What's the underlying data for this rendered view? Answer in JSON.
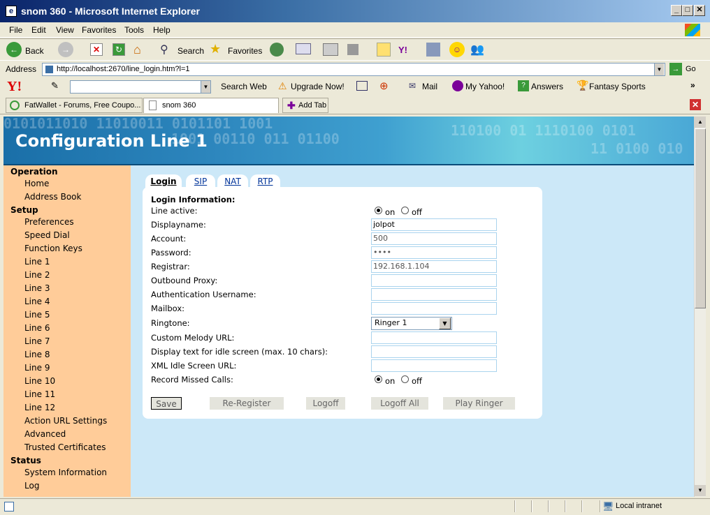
{
  "window": {
    "title": "snom 360 - Microsoft Internet Explorer",
    "icon": "ie-page-icon"
  },
  "menu": [
    "File",
    "Edit",
    "View",
    "Favorites",
    "Tools",
    "Help"
  ],
  "toolbar": {
    "back": "Back",
    "search": "Search",
    "favorites": "Favorites"
  },
  "address": {
    "label": "Address",
    "url": "http://localhost:2670/line_login.htm?l=1",
    "go": "Go"
  },
  "yahoo": {
    "search_web": "Search Web",
    "upgrade": "Upgrade Now!",
    "mail": "Mail",
    "my_yahoo": "My Yahoo!",
    "answers": "Answers",
    "fantasy": "Fantasy Sports"
  },
  "tabs": {
    "tab1": "FatWallet - Forums, Free Coupo...",
    "tab2": "snom 360",
    "add": "Add Tab"
  },
  "page": {
    "header": "Configuration Line 1",
    "sidebar": {
      "operation": "Operation",
      "home": "Home",
      "address_book": "Address Book",
      "setup": "Setup",
      "preferences": "Preferences",
      "speed_dial": "Speed Dial",
      "function_keys": "Function Keys",
      "lines": [
        "Line 1",
        "Line 2",
        "Line 3",
        "Line 4",
        "Line 5",
        "Line 6",
        "Line 7",
        "Line 8",
        "Line 9",
        "Line 10",
        "Line 11",
        "Line 12"
      ],
      "action_url": "Action URL Settings",
      "advanced": "Advanced",
      "trusted": "Trusted Certificates",
      "status": "Status",
      "sysinfo": "System Information",
      "log": "Log"
    },
    "tabs": [
      "Login",
      "SIP",
      "NAT",
      "RTP"
    ],
    "form": {
      "heading": "Login Information:",
      "line_active": "Line active:",
      "on": "on",
      "off": "off",
      "displayname": "Displayname:",
      "displayname_val": "jolpot",
      "account": "Account:",
      "account_val": "500",
      "password": "Password:",
      "password_val": "••••",
      "registrar": "Registrar:",
      "registrar_val": "192.168.1.104",
      "outbound": "Outbound Proxy:",
      "auth_user": "Authentication Username:",
      "mailbox": "Mailbox:",
      "ringtone": "Ringtone:",
      "ringtone_val": "Ringer 1",
      "melody": "Custom Melody URL:",
      "idle_text": "Display text for idle screen (max. 10 chars):",
      "xml_idle": "XML Idle Screen URL:",
      "missed": "Record Missed Calls:"
    },
    "buttons": {
      "save": "Save",
      "reregister": "Re-Register",
      "logoff": "Logoff",
      "logoff_all": "Logoff All",
      "play": "Play Ringer"
    }
  },
  "status": {
    "zone": "Local intranet"
  }
}
